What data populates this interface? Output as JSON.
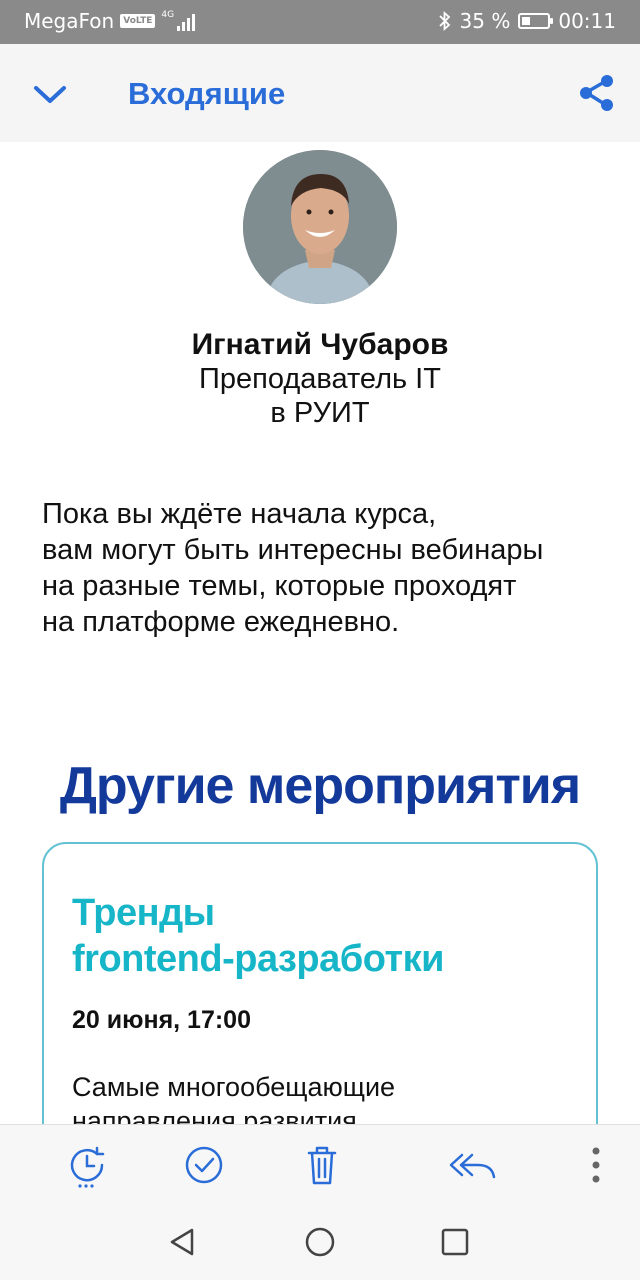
{
  "status_bar": {
    "carrier": "MegaFon",
    "volte": "VoLTE",
    "network": "4G",
    "battery_percent": "35 %",
    "battery_level": 0.35,
    "time": "00:11"
  },
  "app_bar": {
    "title": "Входящие",
    "icons": {
      "back": "chevron-down-icon",
      "share": "share-icon"
    }
  },
  "sender": {
    "name": "Игнатий Чубаров",
    "role_line1": "Преподаватель IT",
    "role_line2": "в РУИТ"
  },
  "intro_lines": [
    "Пока вы ждёте начала курса,",
    "вам могут быть интересны вебинары",
    "на разные темы, которые проходят",
    "на платформе ежедневно."
  ],
  "section_title": "Другие мероприятия",
  "event": {
    "title_line1": "Тренды",
    "title_line2": "frontend-разработки",
    "date": "20 июня, 17:00",
    "desc_line1": "Самые многообещающие",
    "desc_line2": "направления развития"
  },
  "colors": {
    "accent": "#2a6dd8",
    "section_title": "#133a9a",
    "card_title": "#16b5c8",
    "card_border": "#62c2d3"
  },
  "action_bar": [
    "snooze-icon",
    "mark-done-icon",
    "delete-icon",
    "reply-all-icon",
    "more-vert-icon"
  ],
  "nav_bar": [
    "back-triangle-icon",
    "home-circle-icon",
    "recents-square-icon"
  ]
}
